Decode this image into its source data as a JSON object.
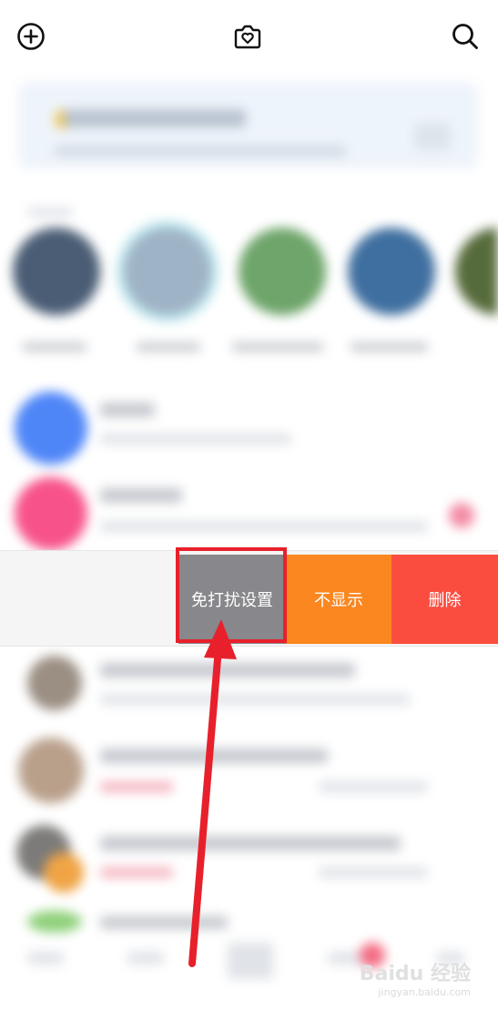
{
  "top_bar": {
    "add_icon": "plus-circle-icon",
    "center_icon": "heart-camera-icon",
    "search_icon": "search-icon"
  },
  "swipe_actions": {
    "do_not_disturb": "免打扰设置",
    "hide": "不显示",
    "delete": "删除"
  },
  "colors": {
    "dnd_bg": "#87878c",
    "hide_bg": "#fb8720",
    "delete_bg": "#fb4d3f",
    "annotation_red": "#e8202b"
  },
  "watermark": {
    "brand": "Baidu 经验",
    "url": "jingyan.baidu.com"
  }
}
